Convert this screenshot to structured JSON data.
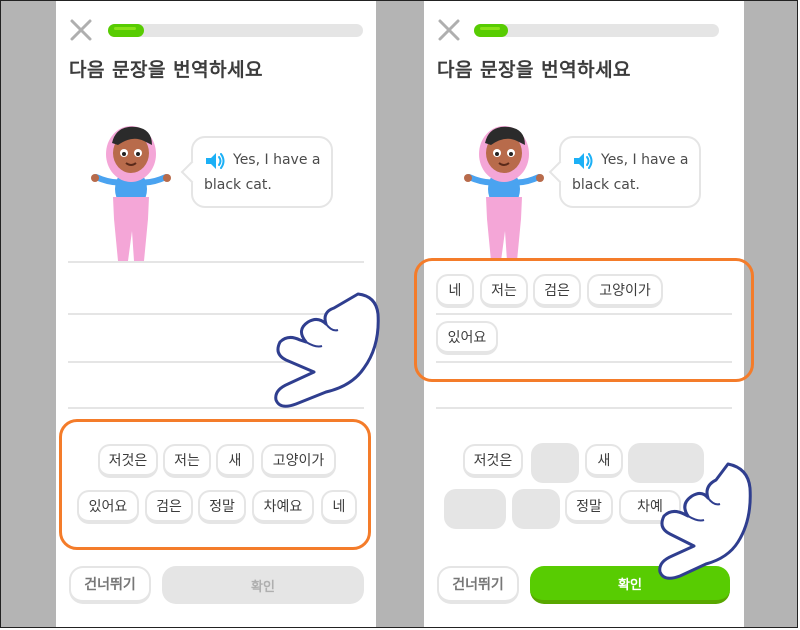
{
  "colors": {
    "accent_green": "#58cc02",
    "highlight_orange": "#f47c2a",
    "border_gray": "#e5e5e5",
    "background_gray": "#b4b4b4",
    "character_pink": "#f4a6d7",
    "character_blue": "#4aa3f0"
  },
  "icons": {
    "close": "close-icon",
    "speaker": "speaker-icon",
    "pointer": "pointing-hand-icon"
  },
  "left_screen": {
    "progress": 0.14,
    "title": "다음 문장을 번역하세요",
    "prompt_line1": "Yes, I have a",
    "prompt_line2": "black cat.",
    "answer_words": [],
    "word_bank": [
      "저것은",
      "저는",
      "새",
      "고양이가",
      "있어요",
      "검은",
      "정말",
      "차예요",
      "네"
    ],
    "skip_label": "건너뛰기",
    "check_label": "확인",
    "check_state": "disabled"
  },
  "right_screen": {
    "progress": 0.14,
    "title": "다음 문장을 번역하세요",
    "prompt_line1": "Yes, I have a",
    "prompt_line2": "black cat.",
    "answer_words": [
      "네",
      "저는",
      "검은",
      "고양이가",
      "있어요"
    ],
    "word_bank_remaining": [
      "저것은",
      "새",
      "정말",
      "차예"
    ],
    "skip_label": "건너뛰기",
    "check_label": "확인",
    "check_state": "active"
  }
}
